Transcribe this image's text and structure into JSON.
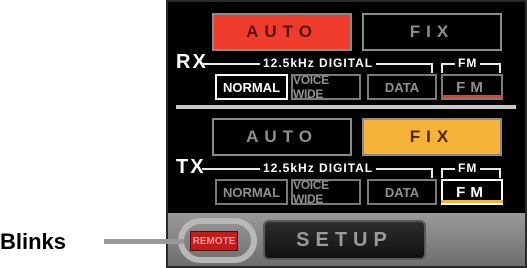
{
  "rx": {
    "side_label": "RX",
    "mode_auto": "AUTO",
    "mode_fix": "FIX",
    "digital_caption": "12.5kHz DIGITAL",
    "fm_caption": "FM",
    "opt_normal": "NORMAL",
    "opt_voice_wide": "VOICE WIDE",
    "opt_data": "DATA",
    "opt_fm": "FM"
  },
  "tx": {
    "side_label": "TX",
    "mode_auto": "AUTO",
    "mode_fix": "FIX",
    "digital_caption": "12.5kHz DIGITAL",
    "fm_caption": "FM",
    "opt_normal": "NORMAL",
    "opt_voice_wide": "VOICE WIDE",
    "opt_data": "DATA",
    "opt_fm": "FM"
  },
  "bottom": {
    "remote_label": "REMOTE",
    "setup_label": "SETUP"
  },
  "annotation": {
    "label": "Blinks"
  },
  "colors": {
    "rx_selected": "#ef3b2c",
    "tx_selected": "#f5b33a",
    "remote_bg": "#c31a1a"
  }
}
